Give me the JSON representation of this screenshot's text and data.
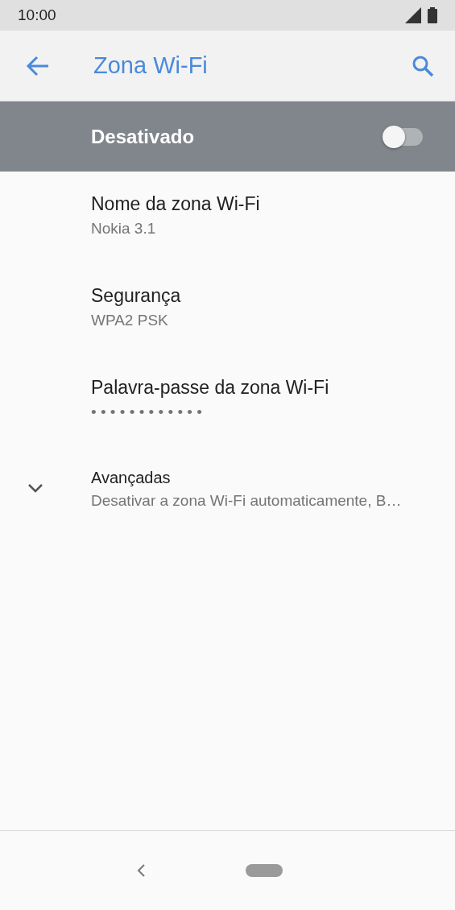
{
  "status_bar": {
    "time": "10:00"
  },
  "app_bar": {
    "title": "Zona Wi-Fi"
  },
  "master_switch": {
    "label": "Desativado",
    "on": false
  },
  "settings": [
    {
      "kind": "setting",
      "title": "Nome da zona Wi-Fi",
      "summary": "Nokia 3.1"
    },
    {
      "kind": "setting",
      "title": "Segurança",
      "summary": "WPA2 PSK"
    },
    {
      "kind": "setting",
      "title": "Palavra-passe da zona Wi-Fi",
      "summary": "• • • • • • • • • • • •"
    },
    {
      "kind": "expandable",
      "title": "Avançadas",
      "summary": "Desativar a zona Wi-Fi automaticamente, B…",
      "expanded": false
    }
  ]
}
